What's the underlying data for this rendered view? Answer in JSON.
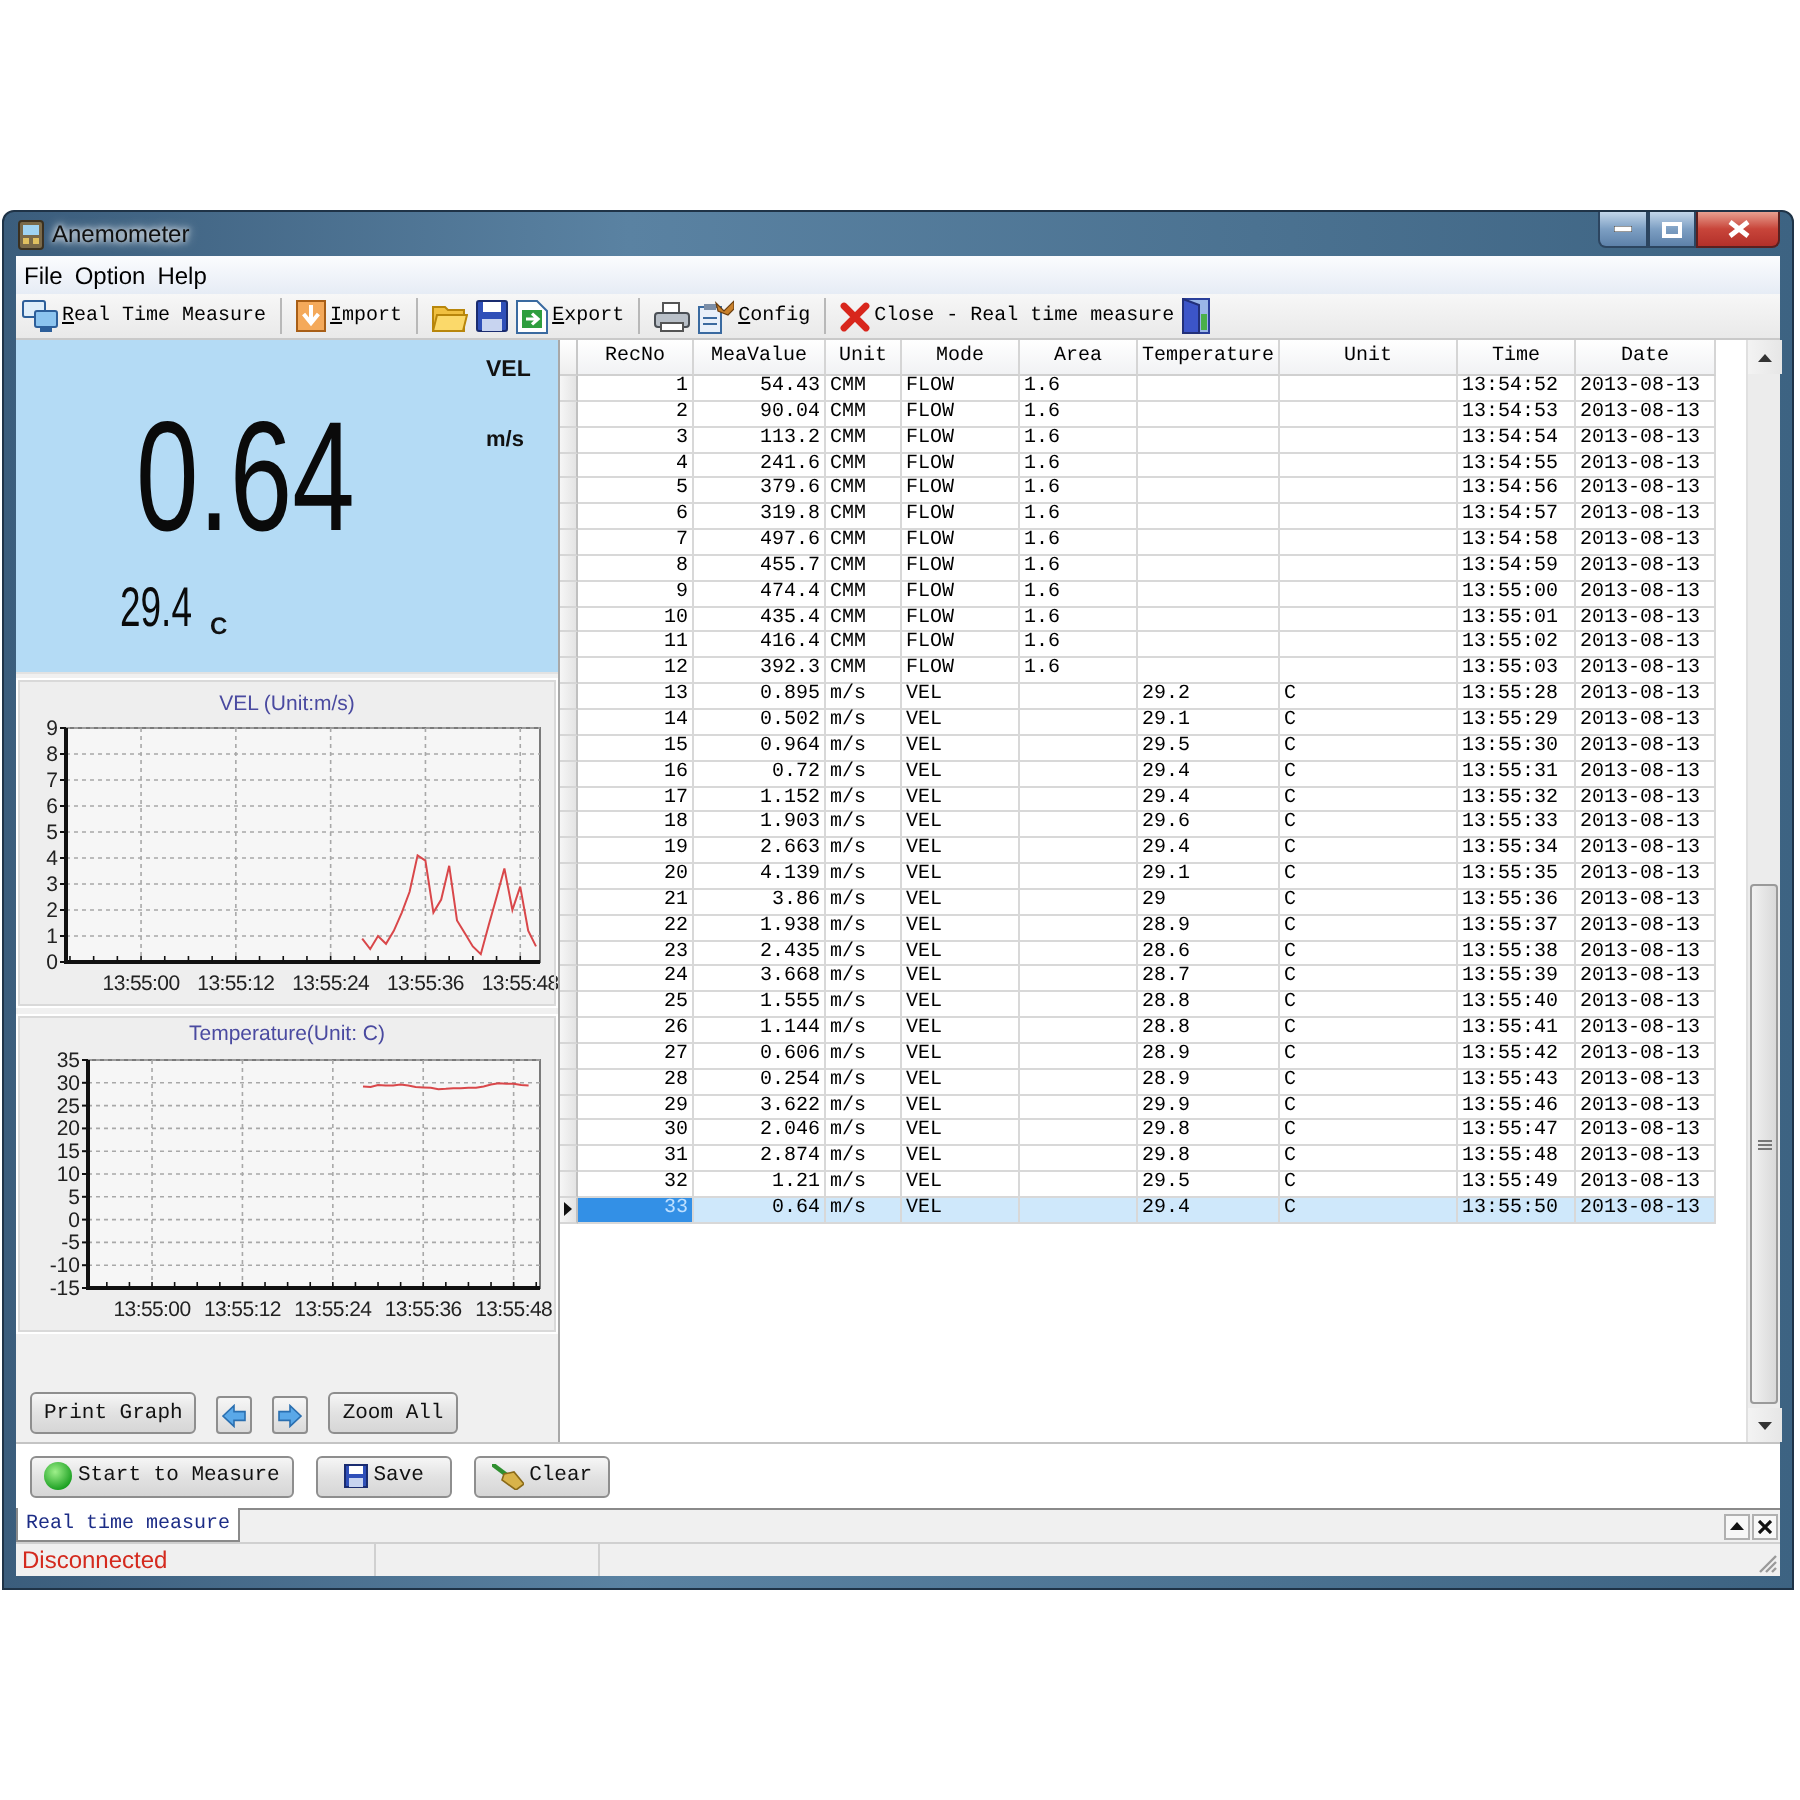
{
  "window": {
    "title": "Anemometer"
  },
  "menu": [
    "File",
    "Option",
    "Help"
  ],
  "toolbar": [
    {
      "label": "Real Time Measure",
      "mnemonic": true
    },
    {
      "label": "Import",
      "mnemonic": true
    },
    {
      "label": "Export",
      "mnemonic": true
    },
    {
      "label": "Config",
      "mnemonic": true
    },
    {
      "label": "Close - Real time measure",
      "mnemonic": false
    }
  ],
  "display": {
    "mode": "VEL",
    "unit": "m/s",
    "value": "0.64",
    "temperature": "29.4",
    "temperature_unit": "C"
  },
  "vel_chart": {
    "chart_data": {
      "type": "line",
      "title": "VEL (Unit:m/s)",
      "grid": true,
      "categories": [
        null,
        null,
        null,
        null,
        null,
        null,
        null,
        null,
        null,
        "13:55:00",
        null,
        null,
        null,
        null,
        null,
        null,
        null,
        null,
        null,
        null,
        null,
        "13:55:12",
        null,
        null,
        null,
        null,
        null,
        null,
        null,
        null,
        null,
        null,
        null,
        "13:55:24",
        null,
        null,
        null,
        null,
        null,
        null,
        null,
        null,
        null,
        null,
        null,
        "13:55:36",
        null,
        null,
        null,
        null,
        null,
        null,
        null,
        null,
        null,
        null,
        null,
        "13:55:48",
        null,
        null
      ],
      "values": [
        null,
        null,
        null,
        null,
        null,
        null,
        null,
        null,
        null,
        null,
        null,
        null,
        null,
        null,
        null,
        null,
        null,
        null,
        null,
        null,
        null,
        null,
        null,
        null,
        null,
        null,
        null,
        null,
        null,
        null,
        null,
        null,
        null,
        null,
        null,
        null,
        null,
        0.9,
        0.5,
        1.0,
        0.7,
        1.2,
        1.9,
        2.7,
        4.1,
        3.9,
        1.9,
        2.4,
        3.7,
        1.6,
        1.1,
        0.6,
        0.3,
        1.4,
        2.5,
        3.6,
        2.0,
        2.9,
        1.2,
        0.6
      ],
      "ylim": [
        0,
        9
      ],
      "yticks": [
        0,
        1,
        2,
        3,
        4,
        5,
        6,
        7,
        8,
        9
      ]
    }
  },
  "temperature_chart": {
    "chart_data": {
      "type": "line",
      "title": "Temperature(Unit: C)",
      "grid": true,
      "categories": [
        null,
        null,
        null,
        null,
        null,
        null,
        null,
        null,
        "13:55:00",
        null,
        null,
        null,
        null,
        null,
        null,
        null,
        null,
        null,
        null,
        null,
        "13:55:12",
        null,
        null,
        null,
        null,
        null,
        null,
        null,
        null,
        null,
        null,
        null,
        "13:55:24",
        null,
        null,
        null,
        null,
        null,
        null,
        null,
        null,
        null,
        null,
        null,
        "13:55:36",
        null,
        null,
        null,
        null,
        null,
        null,
        null,
        null,
        null,
        null,
        null,
        "13:55:48",
        null,
        null,
        null
      ],
      "values": [
        null,
        null,
        null,
        null,
        null,
        null,
        null,
        null,
        null,
        null,
        null,
        null,
        null,
        null,
        null,
        null,
        null,
        null,
        null,
        null,
        null,
        null,
        null,
        null,
        null,
        null,
        null,
        null,
        null,
        null,
        null,
        null,
        null,
        null,
        null,
        null,
        29.2,
        29.1,
        29.5,
        29.4,
        29.4,
        29.6,
        29.4,
        29.1,
        29,
        28.9,
        28.6,
        28.7,
        28.8,
        28.8,
        28.9,
        28.9,
        29.2,
        29.6,
        29.9,
        29.8,
        29.8,
        29.5,
        29.4,
        null
      ],
      "ylim": [
        -15,
        35
      ],
      "yticks": [
        -15,
        -10,
        -5,
        0,
        5,
        10,
        15,
        20,
        25,
        30,
        35
      ]
    }
  },
  "graph_buttons": [
    "Print Graph",
    "Zoom All"
  ],
  "table": {
    "columns": [
      "RecNo",
      "MeaValue",
      "Unit",
      "Mode",
      "Area",
      "Temperature",
      "Unit",
      "Time",
      "Date"
    ],
    "rows": [
      {
        "recno": "1",
        "value": "54.43",
        "unit": "CMM",
        "mode": "FLOW",
        "area": "1.6",
        "time": "13:54:52",
        "date": "2013-08-13",
        "selected": false
      },
      {
        "recno": "2",
        "value": "90.04",
        "unit": "CMM",
        "mode": "FLOW",
        "area": "1.6",
        "time": "13:54:53",
        "date": "2013-08-13",
        "selected": false
      },
      {
        "recno": "3",
        "value": "113.2",
        "unit": "CMM",
        "mode": "FLOW",
        "area": "1.6",
        "time": "13:54:54",
        "date": "2013-08-13",
        "selected": false
      },
      {
        "recno": "4",
        "value": "241.6",
        "unit": "CMM",
        "mode": "FLOW",
        "area": "1.6",
        "time": "13:54:55",
        "date": "2013-08-13",
        "selected": false
      },
      {
        "recno": "5",
        "value": "379.6",
        "unit": "CMM",
        "mode": "FLOW",
        "area": "1.6",
        "time": "13:54:56",
        "date": "2013-08-13",
        "selected": false
      },
      {
        "recno": "6",
        "value": "319.8",
        "unit": "CMM",
        "mode": "FLOW",
        "area": "1.6",
        "time": "13:54:57",
        "date": "2013-08-13",
        "selected": false
      },
      {
        "recno": "7",
        "value": "497.6",
        "unit": "CMM",
        "mode": "FLOW",
        "area": "1.6",
        "time": "13:54:58",
        "date": "2013-08-13",
        "selected": false
      },
      {
        "recno": "8",
        "value": "455.7",
        "unit": "CMM",
        "mode": "FLOW",
        "area": "1.6",
        "time": "13:54:59",
        "date": "2013-08-13",
        "selected": false
      },
      {
        "recno": "9",
        "value": "474.4",
        "unit": "CMM",
        "mode": "FLOW",
        "area": "1.6",
        "time": "13:55:00",
        "date": "2013-08-13",
        "selected": false
      },
      {
        "recno": "10",
        "value": "435.4",
        "unit": "CMM",
        "mode": "FLOW",
        "area": "1.6",
        "time": "13:55:01",
        "date": "2013-08-13",
        "selected": false
      },
      {
        "recno": "11",
        "value": "416.4",
        "unit": "CMM",
        "mode": "FLOW",
        "area": "1.6",
        "time": "13:55:02",
        "date": "2013-08-13",
        "selected": false
      },
      {
        "recno": "12",
        "value": "392.3",
        "unit": "CMM",
        "mode": "FLOW",
        "area": "1.6",
        "time": "13:55:03",
        "date": "2013-08-13",
        "selected": false
      },
      {
        "recno": "13",
        "value": "0.895",
        "unit": "m/s",
        "mode": "VEL",
        "temperature": "29.2",
        "temp_unit": "C",
        "time": "13:55:28",
        "date": "2013-08-13",
        "selected": false
      },
      {
        "recno": "14",
        "value": "0.502",
        "unit": "m/s",
        "mode": "VEL",
        "temperature": "29.1",
        "temp_unit": "C",
        "time": "13:55:29",
        "date": "2013-08-13",
        "selected": false
      },
      {
        "recno": "15",
        "value": "0.964",
        "unit": "m/s",
        "mode": "VEL",
        "temperature": "29.5",
        "temp_unit": "C",
        "time": "13:55:30",
        "date": "2013-08-13",
        "selected": false
      },
      {
        "recno": "16",
        "value": "0.72",
        "unit": "m/s",
        "mode": "VEL",
        "temperature": "29.4",
        "temp_unit": "C",
        "time": "13:55:31",
        "date": "2013-08-13",
        "selected": false
      },
      {
        "recno": "17",
        "value": "1.152",
        "unit": "m/s",
        "mode": "VEL",
        "temperature": "29.4",
        "temp_unit": "C",
        "time": "13:55:32",
        "date": "2013-08-13",
        "selected": false
      },
      {
        "recno": "18",
        "value": "1.903",
        "unit": "m/s",
        "mode": "VEL",
        "temperature": "29.6",
        "temp_unit": "C",
        "time": "13:55:33",
        "date": "2013-08-13",
        "selected": false
      },
      {
        "recno": "19",
        "value": "2.663",
        "unit": "m/s",
        "mode": "VEL",
        "temperature": "29.4",
        "temp_unit": "C",
        "time": "13:55:34",
        "date": "2013-08-13",
        "selected": false
      },
      {
        "recno": "20",
        "value": "4.139",
        "unit": "m/s",
        "mode": "VEL",
        "temperature": "29.1",
        "temp_unit": "C",
        "time": "13:55:35",
        "date": "2013-08-13",
        "selected": false
      },
      {
        "recno": "21",
        "value": "3.86",
        "unit": "m/s",
        "mode": "VEL",
        "temperature": "29",
        "temp_unit": "C",
        "time": "13:55:36",
        "date": "2013-08-13",
        "selected": false
      },
      {
        "recno": "22",
        "value": "1.938",
        "unit": "m/s",
        "mode": "VEL",
        "temperature": "28.9",
        "temp_unit": "C",
        "time": "13:55:37",
        "date": "2013-08-13",
        "selected": false
      },
      {
        "recno": "23",
        "value": "2.435",
        "unit": "m/s",
        "mode": "VEL",
        "temperature": "28.6",
        "temp_unit": "C",
        "time": "13:55:38",
        "date": "2013-08-13",
        "selected": false
      },
      {
        "recno": "24",
        "value": "3.668",
        "unit": "m/s",
        "mode": "VEL",
        "temperature": "28.7",
        "temp_unit": "C",
        "time": "13:55:39",
        "date": "2013-08-13",
        "selected": false
      },
      {
        "recno": "25",
        "value": "1.555",
        "unit": "m/s",
        "mode": "VEL",
        "temperature": "28.8",
        "temp_unit": "C",
        "time": "13:55:40",
        "date": "2013-08-13",
        "selected": false
      },
      {
        "recno": "26",
        "value": "1.144",
        "unit": "m/s",
        "mode": "VEL",
        "temperature": "28.8",
        "temp_unit": "C",
        "time": "13:55:41",
        "date": "2013-08-13",
        "selected": false
      },
      {
        "recno": "27",
        "value": "0.606",
        "unit": "m/s",
        "mode": "VEL",
        "temperature": "28.9",
        "temp_unit": "C",
        "time": "13:55:42",
        "date": "2013-08-13",
        "selected": false
      },
      {
        "recno": "28",
        "value": "0.254",
        "unit": "m/s",
        "mode": "VEL",
        "temperature": "28.9",
        "temp_unit": "C",
        "time": "13:55:43",
        "date": "2013-08-13",
        "selected": false
      },
      {
        "recno": "29",
        "value": "3.622",
        "unit": "m/s",
        "mode": "VEL",
        "temperature": "29.9",
        "temp_unit": "C",
        "time": "13:55:46",
        "date": "2013-08-13",
        "selected": false
      },
      {
        "recno": "30",
        "value": "2.046",
        "unit": "m/s",
        "mode": "VEL",
        "temperature": "29.8",
        "temp_unit": "C",
        "time": "13:55:47",
        "date": "2013-08-13",
        "selected": false
      },
      {
        "recno": "31",
        "value": "2.874",
        "unit": "m/s",
        "mode": "VEL",
        "temperature": "29.8",
        "temp_unit": "C",
        "time": "13:55:48",
        "date": "2013-08-13",
        "selected": false
      },
      {
        "recno": "32",
        "value": "1.21",
        "unit": "m/s",
        "mode": "VEL",
        "temperature": "29.5",
        "temp_unit": "C",
        "time": "13:55:49",
        "date": "2013-08-13",
        "selected": false
      },
      {
        "recno": "33",
        "value": "0.64",
        "unit": "m/s",
        "mode": "VEL",
        "temperature": "29.4",
        "temp_unit": "C",
        "time": "13:55:50",
        "date": "2013-08-13",
        "selected": true
      }
    ]
  },
  "action_buttons": [
    "Start to Measure",
    "Save",
    "Clear"
  ],
  "document_tabs": [
    {
      "label": "Real time measure",
      "selected": true
    }
  ],
  "status_bar": {
    "text": "Disconnected"
  }
}
